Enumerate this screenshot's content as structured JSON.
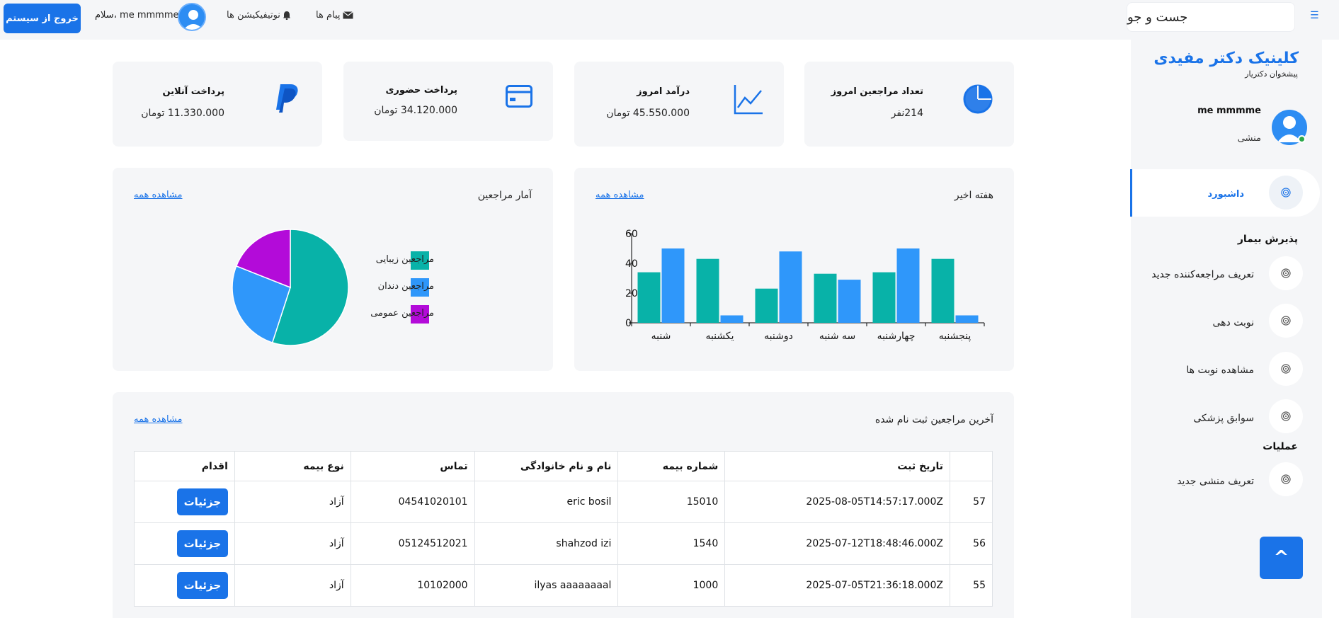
{
  "topbar": {
    "logout_label": "خروج از سیستم",
    "greeting": "سلام، me mmmme",
    "notifications_label": "نوتیفیکیشن ها",
    "messages_label": "پیام ها",
    "search_placeholder": "جست و جو",
    "menu_icon": "hamburger-icon"
  },
  "sidebar": {
    "brand": "کلینیک دکتر مفیدی",
    "brand_sub": "پیشخوان دکتریار",
    "user_name": "me mmmme",
    "user_role": "منشی",
    "active_item": "داشبورد",
    "sections": [
      {
        "title": "پذیرش بیمار",
        "items": [
          "تعریف مراجعه‌کننده جدید",
          "نوبت دهی",
          "مشاهده نوبت ها",
          "سوابق پزشکی"
        ]
      },
      {
        "title": "عملیات",
        "items": [
          "تعریف منشی جدید"
        ]
      }
    ],
    "scroll_top_label": "^"
  },
  "stats": [
    {
      "title": "تعداد مراجعین امروز",
      "value": "214نفر",
      "icon": "pie-chart-icon"
    },
    {
      "title": "درآمد امروز",
      "value": "45.550.000 تومان",
      "icon": "line-chart-icon"
    },
    {
      "title": "پرداخت حضوری",
      "value": "34.120.000 تومان",
      "icon": "credit-card-icon"
    },
    {
      "title": "پرداخت آنلاین",
      "value": "11.330.000 تومان",
      "icon": "paypal-icon"
    }
  ],
  "weekly_panel": {
    "title": "هفته اخیر",
    "see_all": "مشاهده همه"
  },
  "patients_panel": {
    "title": "آمار مراجعین",
    "see_all": "مشاهده همه"
  },
  "chart_data": [
    {
      "type": "bar",
      "title": "هفته اخیر",
      "categories": [
        "شنبه",
        "یکشنبه",
        "دوشنبه",
        "سه شنبه",
        "چهارشنبه",
        "پنجشنبه"
      ],
      "series": [
        {
          "values": [
            34,
            43,
            23,
            33,
            34,
            43
          ],
          "color": "#08b2a8"
        },
        {
          "values": [
            50,
            5,
            48,
            29,
            50,
            5
          ],
          "color": "#2f97fa"
        }
      ],
      "ylim": [
        0,
        60
      ],
      "yticks": [
        0,
        20,
        40,
        60
      ]
    },
    {
      "type": "pie",
      "title": "آمار مراجعین",
      "labels": [
        "مراجعین زیبایی",
        "مراجعین دندان",
        "مراجعین عمومی"
      ],
      "values": [
        55,
        26,
        19
      ],
      "colors": [
        "#08b2a8",
        "#2f97fa",
        "#b30bd9"
      ]
    }
  ],
  "recent": {
    "title": "آخرین مراجعین ثبت نام شده",
    "see_all": "مشاهده همه",
    "headers": [
      "",
      "تاریخ ثبت",
      "شماره بیمه",
      "نام و نام خانوادگی",
      "تماس",
      "نوع بیمه",
      "اقدام"
    ],
    "rows": [
      {
        "id": "57",
        "date": "2025-08-05T14:57:17.000Z",
        "insurance_no": "15010",
        "name": "eric bosil",
        "phone": "04541020101",
        "insurance_type": "آزاد",
        "action": "جزئیات"
      },
      {
        "id": "56",
        "date": "2025-07-12T18:48:46.000Z",
        "insurance_no": "1540",
        "name": "shahzod izi",
        "phone": "05124512021",
        "insurance_type": "آزاد",
        "action": "جزئیات"
      },
      {
        "id": "55",
        "date": "2025-07-05T21:36:18.000Z",
        "insurance_no": "1000",
        "name": "ilyas aaaaaaaal",
        "phone": "10102000",
        "insurance_type": "آزاد",
        "action": "جزئیات"
      }
    ]
  }
}
